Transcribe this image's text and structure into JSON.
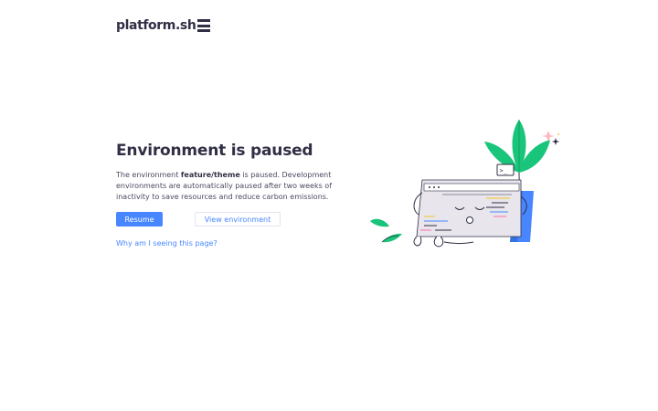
{
  "brand": {
    "name": "platform.sh",
    "color": "#302f45",
    "accent": "#4786ff"
  },
  "main": {
    "title": "Environment is paused",
    "description": {
      "prefix": "The environment ",
      "env_name": "feature/theme",
      "suffix": " is paused. Development environments are automatically paused after two weeks of inactivity to save resources and reduce carbon emissions."
    },
    "primary_button": "Resume",
    "secondary_button": "View environment",
    "help_link": "Why am I seeing this page?"
  },
  "illustration": {
    "icon": "sleeping-laptop-plant-illustration",
    "terminal_glyph": ">_"
  }
}
